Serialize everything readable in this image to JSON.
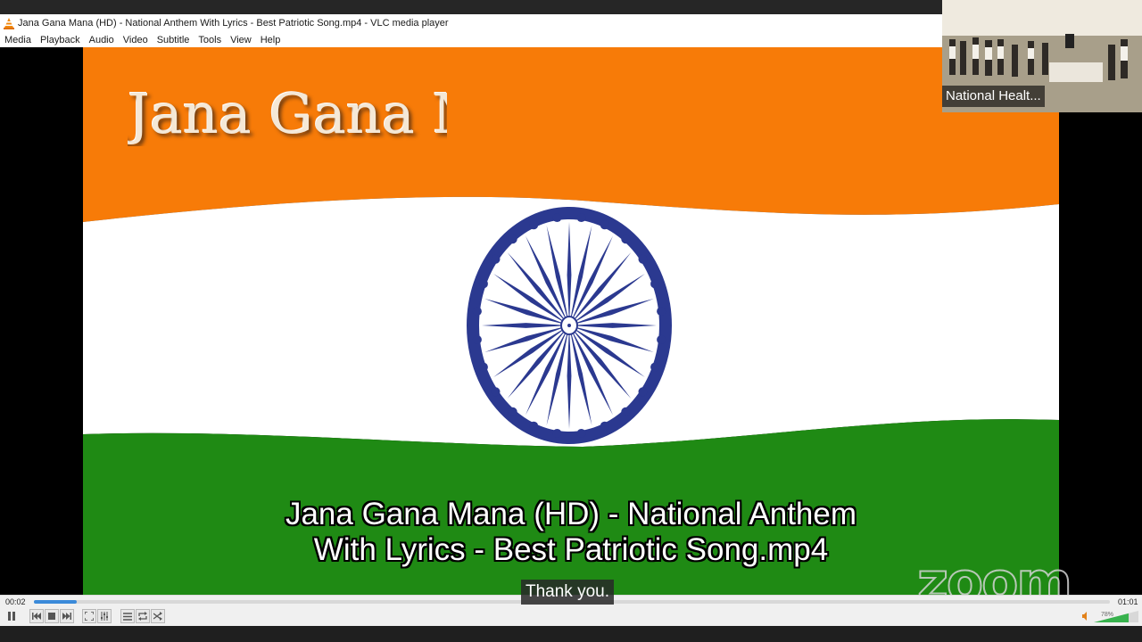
{
  "window": {
    "title": "Jana Gana Mana (HD) - National Anthem With Lyrics - Best Patriotic Song.mp4 - VLC media player"
  },
  "menu": [
    "Media",
    "Playback",
    "Audio",
    "Video",
    "Subtitle",
    "Tools",
    "View",
    "Help"
  ],
  "video": {
    "overlay_title": "Jana Gana Ma",
    "subtitle_line1": "Jana Gana Mana (HD) - National Anthem",
    "subtitle_line2": "With Lyrics - Best Patriotic Song.mp4",
    "watermark": "zoom",
    "colors": {
      "saffron": "#f77b08",
      "white": "#ffffff",
      "green": "#1f8a14",
      "chakra": "#2b3990"
    }
  },
  "caption": "Thank you.",
  "controls": {
    "elapsed": "00:02",
    "duration": "01:01",
    "progress_fraction": 0.04,
    "volume": "78%",
    "volume_fraction": 0.78,
    "accent": "#3b8ad9",
    "buttons": [
      "pause-icon",
      "previous-icon",
      "stop-icon",
      "next-icon",
      "fullscreen-icon",
      "extended-settings-icon",
      "playlist-icon",
      "loop-icon",
      "shuffle-icon"
    ]
  },
  "participant": {
    "name": "National Healt..."
  }
}
